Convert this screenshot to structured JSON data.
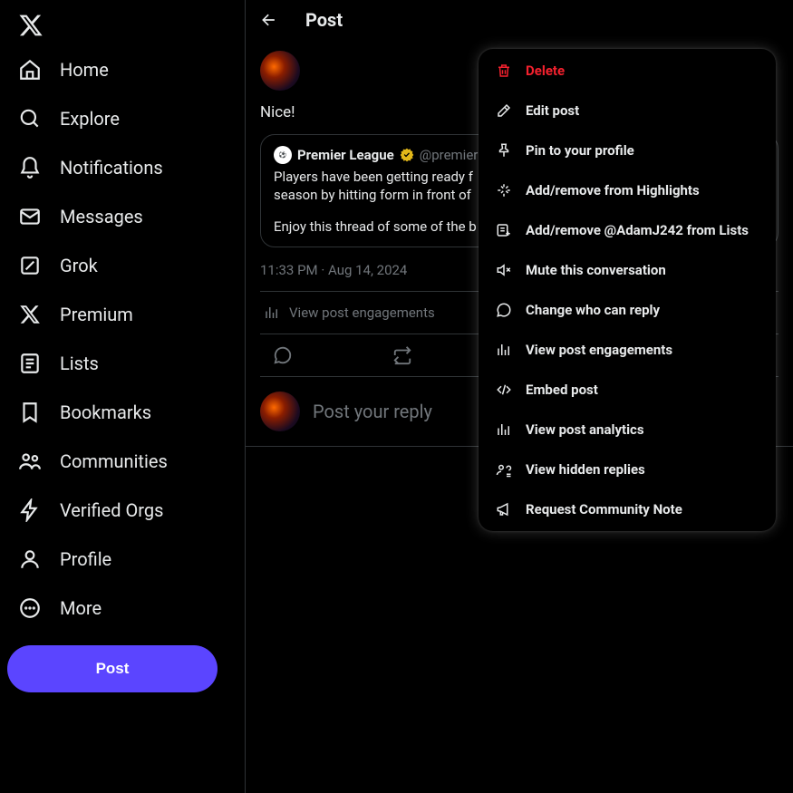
{
  "header": {
    "title": "Post"
  },
  "sidebar": {
    "items": [
      {
        "label": "Home"
      },
      {
        "label": "Explore"
      },
      {
        "label": "Notifications"
      },
      {
        "label": "Messages"
      },
      {
        "label": "Grok"
      },
      {
        "label": "Premium"
      },
      {
        "label": "Lists"
      },
      {
        "label": "Bookmarks"
      },
      {
        "label": "Communities"
      },
      {
        "label": "Verified Orgs"
      },
      {
        "label": "Profile"
      },
      {
        "label": "More"
      }
    ],
    "post_button": "Post"
  },
  "post": {
    "text": "Nice!",
    "timestamp": "11:33 PM · Aug 14, 2024",
    "view_engagements": "View post engagements",
    "quoted": {
      "name": "Premier League",
      "handle": "@premier",
      "avatar_badge": "PL",
      "line1": "Players have been getting ready f",
      "line2": "season by hitting form in front of",
      "line3": "Enjoy this thread of some of the b"
    }
  },
  "reply": {
    "placeholder": "Post your reply"
  },
  "menu": {
    "items": [
      {
        "label": "Delete",
        "danger": true
      },
      {
        "label": "Edit post"
      },
      {
        "label": "Pin to your profile"
      },
      {
        "label": "Add/remove from Highlights"
      },
      {
        "label": "Add/remove @AdamJ242 from Lists"
      },
      {
        "label": "Mute this conversation"
      },
      {
        "label": "Change who can reply"
      },
      {
        "label": "View post engagements"
      },
      {
        "label": "Embed post"
      },
      {
        "label": "View post analytics"
      },
      {
        "label": "View hidden replies"
      },
      {
        "label": "Request Community Note"
      }
    ]
  }
}
